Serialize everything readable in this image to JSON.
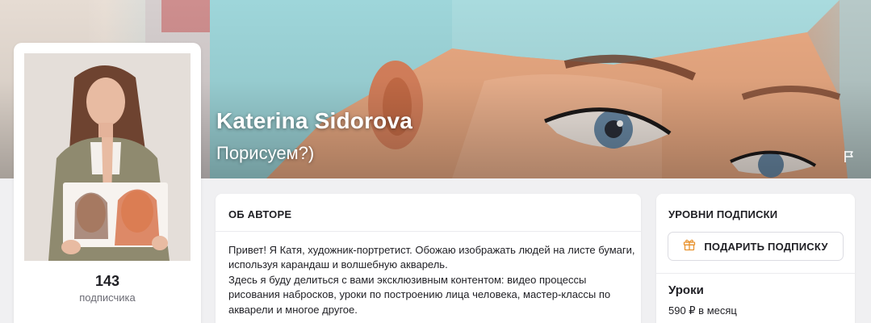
{
  "creator": {
    "name": "Katerina Sidorova",
    "tagline": "Порисуем?)"
  },
  "profile": {
    "subscribers_count": "143",
    "subscribers_label": "подписчика"
  },
  "about": {
    "title": "ОБ АВТОРЕ",
    "paragraph_1": "Привет! Я Катя, художник-портретист. Обожаю изображать людей на листе бумаги, используя карандаш и волшебную акварель.",
    "paragraph_2": "Здесь я буду делиться с вами эксклюзивным контентом: видео процессы рисования набросков, уроки по построению лица человека, мастер-классы по акварели и многое другое."
  },
  "tiers": {
    "title": "УРОВНИ ПОДПИСКИ",
    "gift_button_label": "ПОДАРИТЬ ПОДПИСКУ",
    "items": [
      {
        "name": "Уроки",
        "price": "590 ₽ в месяц"
      }
    ]
  },
  "icons": {
    "gift": "gift-icon",
    "report": "flag-icon"
  },
  "colors": {
    "page_background": "#f0f0f2",
    "card_background": "#ffffff",
    "gift_icon": "#e8922e",
    "text_primary": "#1f1f24",
    "text_secondary": "#6b6b74"
  }
}
